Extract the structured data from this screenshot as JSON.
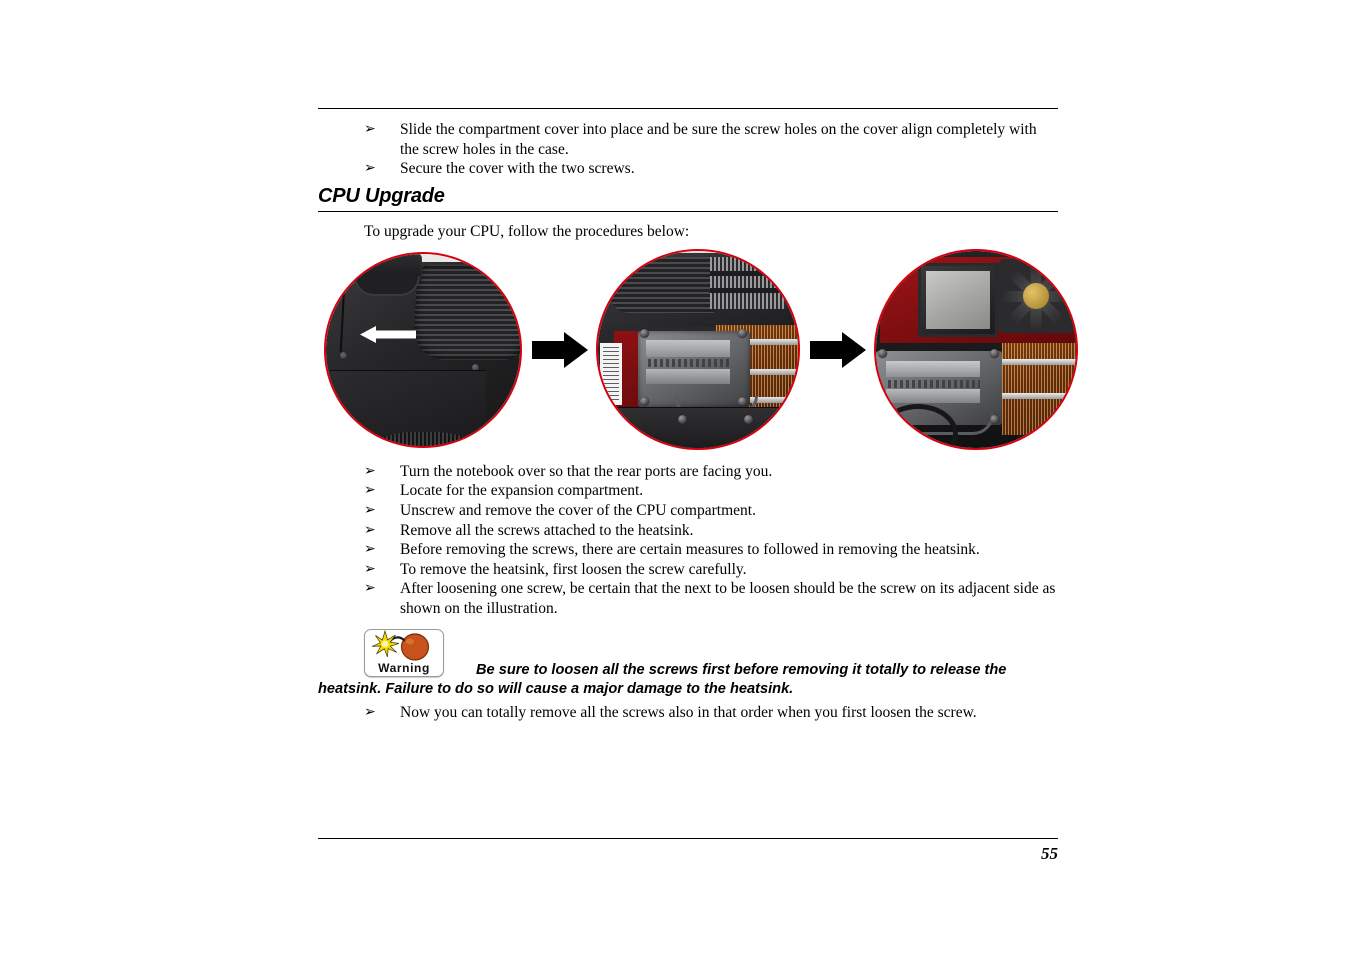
{
  "document": {
    "page_number": "55",
    "accent_rule_color": "#000000",
    "photo_border_color": "#d8000c"
  },
  "top_bullets": [
    {
      "glyph": "➢",
      "text": "Slide the compartment cover into place and be sure the screw holes on the cover align completely with the screw holes in the case."
    },
    {
      "glyph": "➢",
      "text": "Secure the cover with the two screws."
    }
  ],
  "section": {
    "heading": "CPU Upgrade",
    "intro": "To upgrade your CPU, follow the procedures below:"
  },
  "figure": {
    "photos": [
      {
        "caption_semantic": "notebook-underside-expansion-compartment",
        "alt": "Bottom of notebook showing the expansion compartment cover with a white arrow indicating the slide direction"
      },
      {
        "caption_semantic": "open-cpu-compartment-heatsink",
        "alt": "Opened CPU compartment showing the heatsink and copper heat pipe fins"
      },
      {
        "caption_semantic": "heatsink-removed-cpu-socket",
        "alt": "Heatsink removed revealing the CPU socket on the red mainboard with the cooling fan"
      }
    ],
    "arrows": [
      {
        "direction": "right"
      },
      {
        "direction": "right"
      }
    ]
  },
  "procedure_bullets": [
    {
      "glyph": "➢",
      "text": "Turn the notebook over so that the rear ports are facing you."
    },
    {
      "glyph": "➢",
      "text": "Locate for the expansion compartment."
    },
    {
      "glyph": "➢",
      "text": "Unscrew and remove the cover of the CPU compartment."
    },
    {
      "glyph": "➢",
      "text": "Remove all the screws attached to the heatsink."
    },
    {
      "glyph": "➢",
      "text": "Before removing the screws, there are certain measures to followed in removing the heatsink."
    },
    {
      "glyph": "➢",
      "text": "To remove the heatsink, first loosen the screw carefully."
    },
    {
      "glyph": "➢",
      "text": "After loosening one screw, be certain that the next to be loosen should be the screw on its adjacent side as shown on the illustration."
    }
  ],
  "warning": {
    "icon_label": "Warning",
    "icon_name": "bomb-warning-icon",
    "bomb_color": "#c8521c",
    "spark_color": "#f5d800",
    "text": "Be sure to loosen all the screws first before removing it totally to release the heatsink.  Failure to do so will cause a major damage to the heatsink."
  },
  "final_bullets": [
    {
      "glyph": "➢",
      "text": "Now you can totally remove all the screws also in that order when you first loosen the screw."
    }
  ]
}
